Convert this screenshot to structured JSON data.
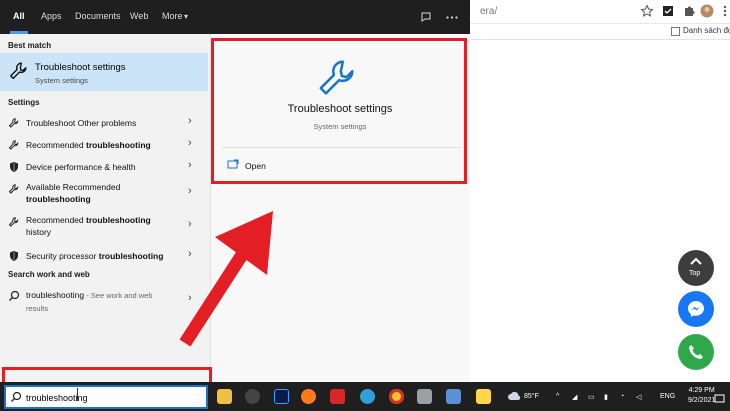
{
  "browser": {
    "url_tail": "era/",
    "bookmark_label": "Danh sách đọc"
  },
  "start_menu": {
    "tabs": [
      {
        "label": "All",
        "active": true
      },
      {
        "label": "Apps"
      },
      {
        "label": "Documents"
      },
      {
        "label": "Web"
      },
      {
        "label": "More"
      }
    ],
    "more_chevron": "▾",
    "best_match_header": "Best match",
    "best_match": {
      "title": "Troubleshoot settings",
      "subtitle": "System settings",
      "icon": "wrench-icon"
    },
    "settings_header": "Settings",
    "settings_items": [
      {
        "pre": "Troubleshoot Other problems",
        "bold": "",
        "line2_pre": "",
        "line2_bold": "",
        "line2_post": "",
        "icon": "wrench-icon"
      },
      {
        "pre": "Recommended ",
        "bold": "troubleshooting",
        "line2_pre": "",
        "line2_bold": "",
        "line2_post": "",
        "icon": "wrench-icon"
      },
      {
        "pre": "Device performance & health",
        "bold": "",
        "line2_pre": "",
        "line2_bold": "",
        "line2_post": "",
        "icon": "shield-icon"
      },
      {
        "pre": "Available Recommended",
        "bold": "",
        "line2_pre": "",
        "line2_bold": "troubleshooting",
        "line2_post": "",
        "icon": "wrench-icon"
      },
      {
        "pre": "Recommended ",
        "bold": "troubleshooting",
        "line2_pre": "history",
        "line2_bold": "",
        "line2_post": "",
        "icon": "wrench-icon"
      },
      {
        "pre": "Security processor ",
        "bold": "troubleshooting",
        "line2_pre": "",
        "line2_bold": "",
        "line2_post": "",
        "icon": "shield-icon"
      }
    ],
    "web_header": "Search work and web",
    "web_item": {
      "query": "troubleshooting",
      "suffix": " - See work and web",
      "line2": "results"
    },
    "chevron": "›",
    "detail": {
      "title": "Troubleshoot settings",
      "subtitle": "System settings",
      "open_label": "Open"
    }
  },
  "search": {
    "value": "troubleshooting"
  },
  "taskbar": {
    "temperature": "85°F",
    "language": "ENG",
    "time": "4:29 PM",
    "date": "9/2/2021"
  },
  "floating": {
    "top_label": "Top"
  },
  "colors": {
    "accent": "#1a73c9",
    "highlight": "#e31e24",
    "selected": "#cce4f7"
  }
}
